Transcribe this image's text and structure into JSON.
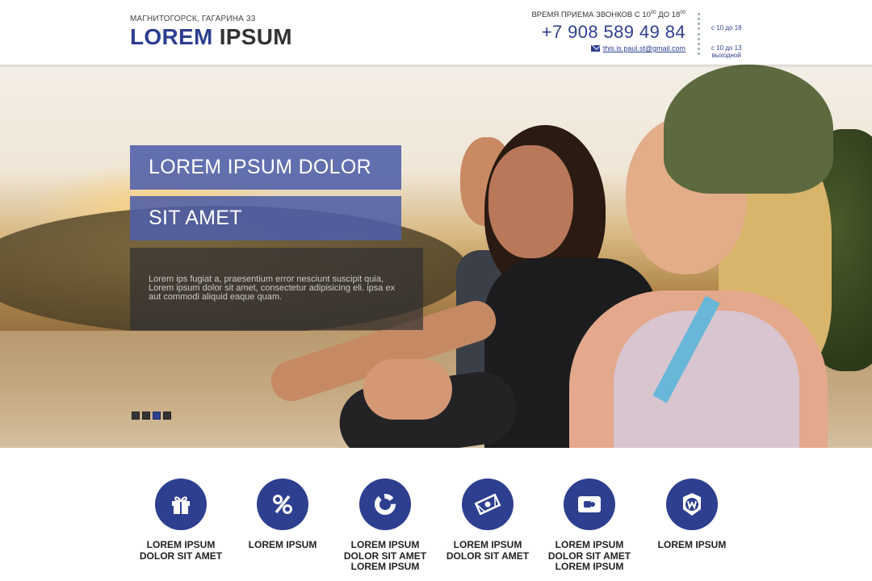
{
  "header": {
    "address": "МАГНИТОГОРСК, ГАГАРИНА 33",
    "logo_part1": "LOREM",
    "logo_part2": "IPSUM",
    "hours_prefix": "ВРЕМЯ ПРИЕМА ЗВОНКОВ С 10",
    "hours_sup1": "00",
    "hours_mid": " ДО 18",
    "hours_sup2": "00",
    "phone": "+7 908 589 49 84",
    "email": "this.is.paul.st@gmail.com",
    "schedule_weekday": "с 10 до 18",
    "schedule_weekend": "с 10 до 13",
    "schedule_weekend_note": "выходной"
  },
  "hero": {
    "slogan_line1": "LOREM IPSUM DOLOR",
    "slogan_line2": "SIT AMET",
    "description": "Lorem ips fugiat a, praesentium error nesciunt suscipit quia, Lorem ipsum dolor sit amet, consectetur adipisicing eli. ipsa ex aut commodi aliquid eaque quam.",
    "slides": [
      {
        "active": false
      },
      {
        "active": false
      },
      {
        "active": true
      },
      {
        "active": false
      }
    ]
  },
  "features": [
    {
      "icon": "gift-icon",
      "lines": [
        "LOREM IPSUM",
        "DOLOR SIT AMET"
      ]
    },
    {
      "icon": "percent-icon",
      "lines": [
        "LOREM IPSUM"
      ]
    },
    {
      "icon": "donut-chart-icon",
      "lines": [
        "LOREM IPSUM",
        "DOLOR SIT AMET",
        "LOREM IPSUM"
      ]
    },
    {
      "icon": "banknote-icon",
      "lines": [
        "LOREM IPSUM",
        "DOLOR SIT AMET"
      ]
    },
    {
      "icon": "card-icon",
      "lines": [
        "LOREM IPSUM",
        "DOLOR SIT AMET",
        "LOREM IPSUM"
      ]
    },
    {
      "icon": "badge-w-icon",
      "lines": [
        "LOREM IPSUM"
      ]
    }
  ],
  "colors": {
    "brand": "#2e3f8f",
    "slogan_bg": "#4e5fa8",
    "desc_bg": "#2d2d32"
  }
}
